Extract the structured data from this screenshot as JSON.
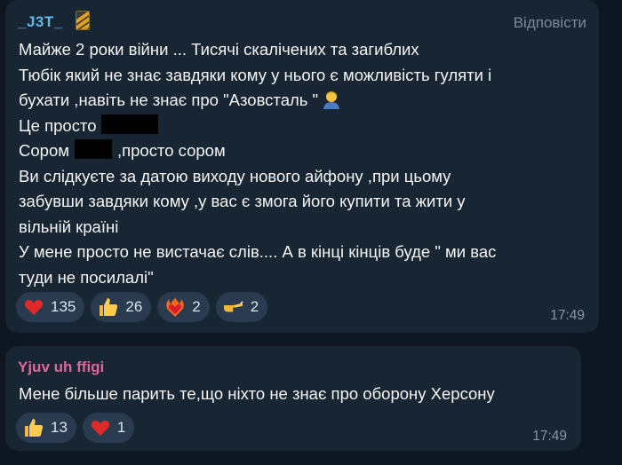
{
  "messages": [
    {
      "author": "_J3T_",
      "reply_label": "Відповісти",
      "lines": [
        "Майже 2 роки війни ... Тисячі скалічених та загиблих",
        "Тюбік який не знає завдяки кому у нього є можливість гуляти і",
        "бухати ,навіть не знає про \"Азовсталь \"",
        "Це просто",
        "Сором",
        ",просто сором",
        "Ви слідкуєте за датою виходу нового айфону ,при цьому",
        "забувши завдяки кому ,у вас є змога його купити та жити у",
        "вільній країні",
        "У мене просто не вистачає слів.... А в кінці кінців буде \" ми вас",
        "туди не посилалі\""
      ],
      "reactions": [
        {
          "icon": "heart-icon",
          "count": "135"
        },
        {
          "icon": "thumbs-up-icon",
          "count": "26"
        },
        {
          "icon": "heart-on-fire-icon",
          "count": "2"
        },
        {
          "icon": "pointing-hand-icon",
          "count": "2"
        }
      ],
      "time": "17:49"
    },
    {
      "author": "Yjuv uh ffigi",
      "lines": [
        "Мене більше парить те,що ніхто не знає про оборону Херсону"
      ],
      "reactions": [
        {
          "icon": "thumbs-up-icon",
          "count": "13"
        },
        {
          "icon": "heart-icon",
          "count": "1"
        }
      ],
      "time": "17:49"
    }
  ],
  "colors": {
    "background": "#0e1621",
    "bubble": "#182533",
    "author1": "#66b8e8",
    "author2": "#e0679a",
    "reaction_pill": "#2b3b4f"
  }
}
